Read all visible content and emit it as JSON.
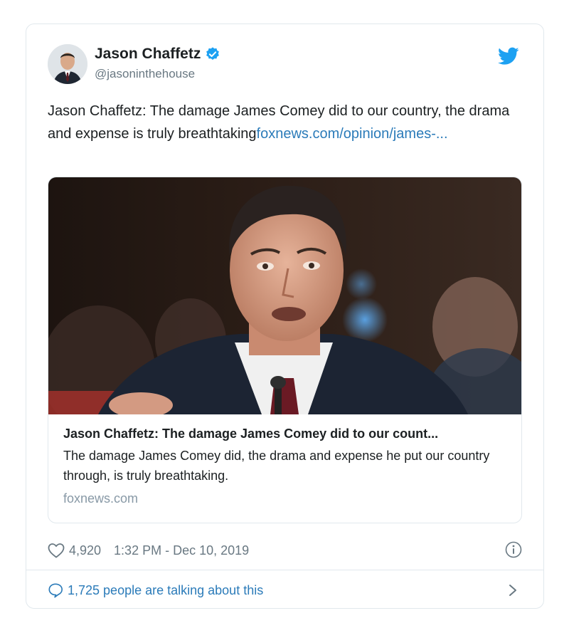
{
  "author": {
    "name": "Jason Chaffetz",
    "handle": "@jasoninthehouse",
    "verified": true
  },
  "tweet": {
    "text": "Jason Chaffetz: The damage James Comey did to our country, the drama and expense is truly breathtaking",
    "link_text": "foxnews.com/opinion/james-..."
  },
  "card": {
    "title": "Jason Chaffetz: The damage James Comey did to our count...",
    "description": "The damage James Comey did, the drama and expense he put our country through, is truly breathtaking.",
    "domain": "foxnews.com"
  },
  "meta": {
    "likes": "4,920",
    "timestamp": "1:32 PM - Dec 10, 2019"
  },
  "footer": {
    "talking": "1,725 people are talking about this"
  },
  "colors": {
    "link": "#2b7bb9",
    "text": "#1c2022",
    "secondary": "#697882",
    "border": "#e1e8ed",
    "twitter_blue": "#1da1f2"
  },
  "icons": [
    "verified-badge-icon",
    "twitter-bird-icon",
    "heart-icon",
    "info-icon",
    "speech-bubble-icon",
    "chevron-right-icon"
  ]
}
